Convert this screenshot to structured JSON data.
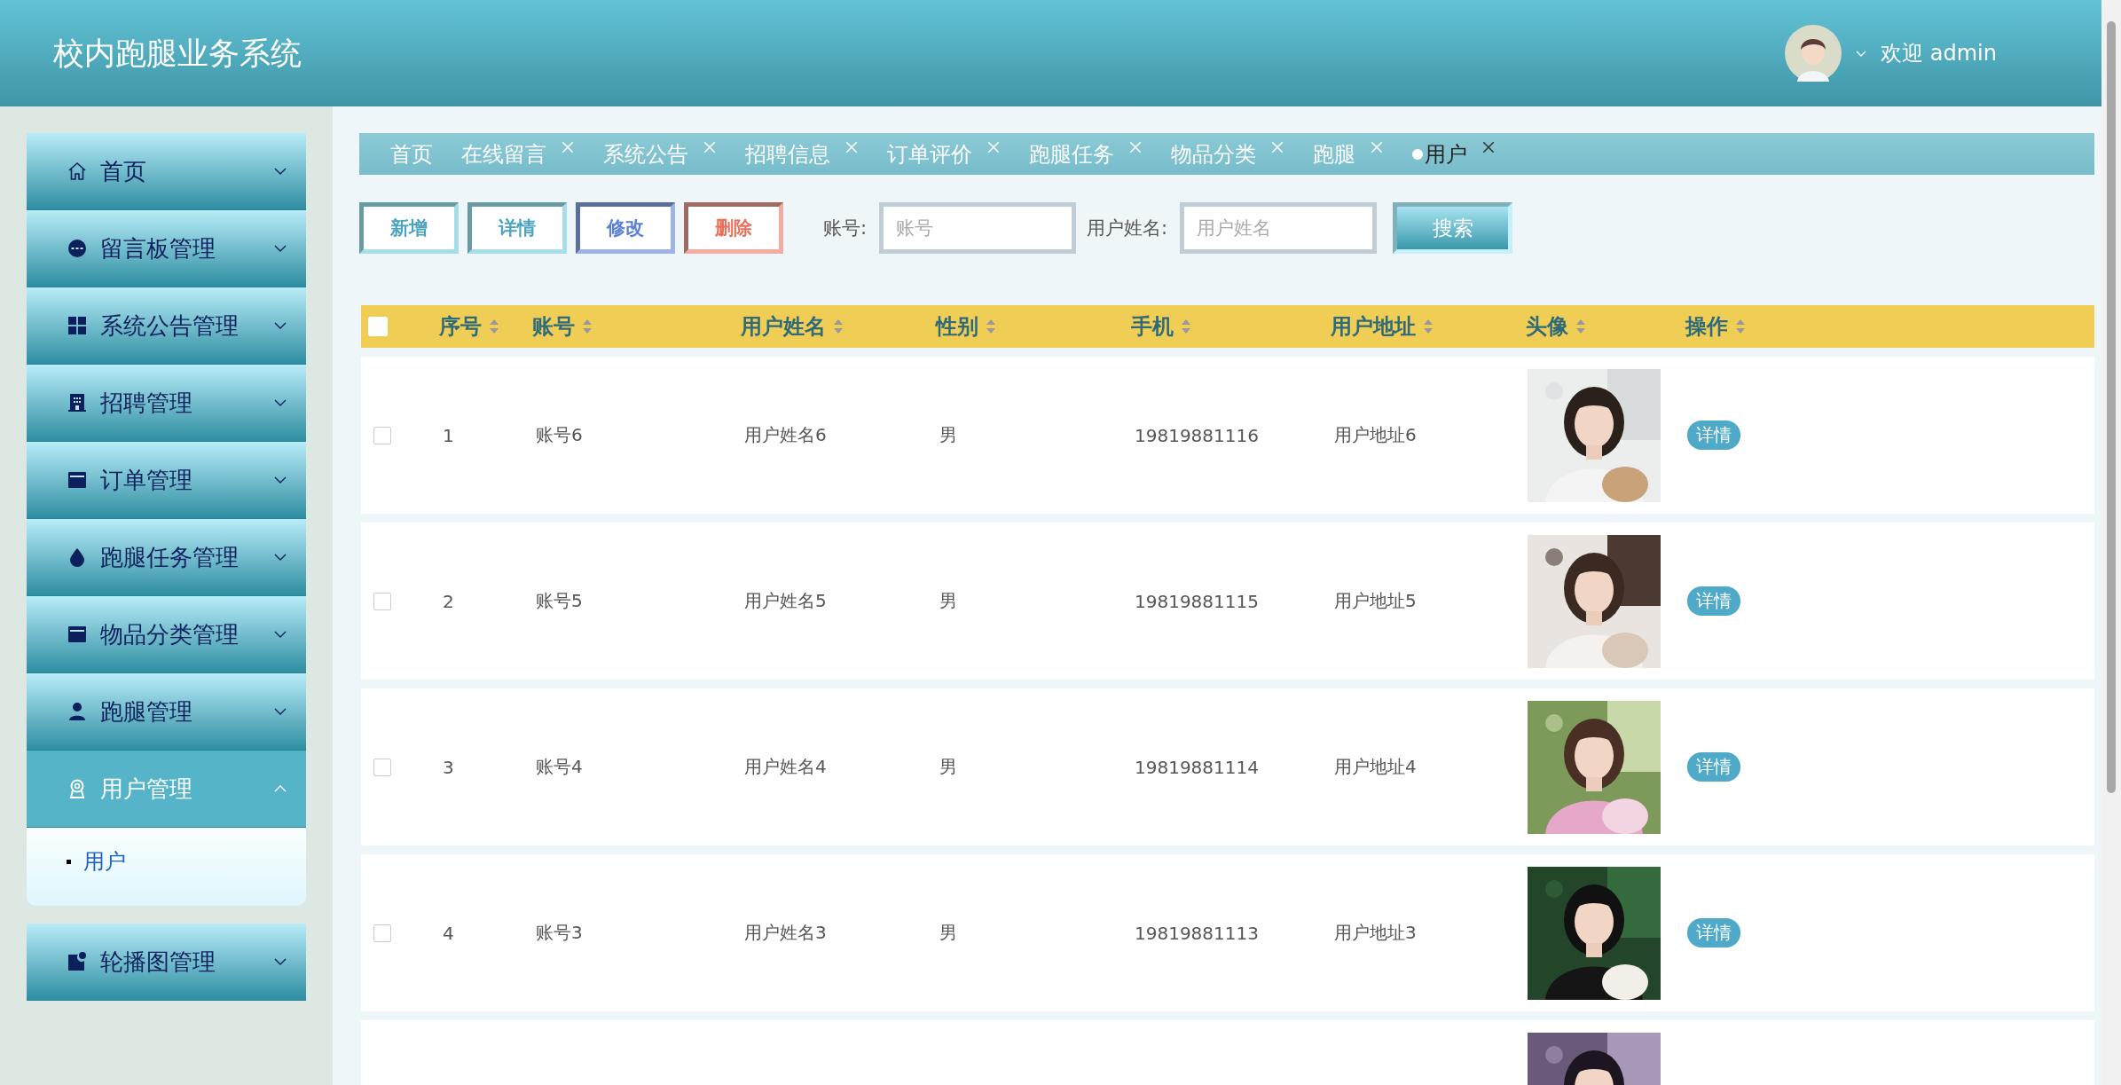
{
  "header": {
    "title": "校内跑腿业务系统",
    "welcome": "欢迎 admin"
  },
  "sidebar": {
    "items": [
      {
        "label": "首页",
        "selected": false,
        "expanded": false
      },
      {
        "label": "留言板管理",
        "selected": false,
        "expanded": false
      },
      {
        "label": "系统公告管理",
        "selected": false,
        "expanded": false
      },
      {
        "label": "招聘管理",
        "selected": false,
        "expanded": false
      },
      {
        "label": "订单管理",
        "selected": false,
        "expanded": false
      },
      {
        "label": "跑腿任务管理",
        "selected": false,
        "expanded": false
      },
      {
        "label": "物品分类管理",
        "selected": false,
        "expanded": false
      },
      {
        "label": "跑腿管理",
        "selected": false,
        "expanded": false
      },
      {
        "label": "用户管理",
        "selected": true,
        "expanded": true,
        "children": [
          {
            "label": "用户",
            "selected": true
          }
        ]
      },
      {
        "label": "轮播图管理",
        "selected": false,
        "expanded": false
      }
    ]
  },
  "tabs": [
    {
      "label": "首页",
      "selected": false,
      "closable": false
    },
    {
      "label": "在线留言",
      "selected": false,
      "closable": true
    },
    {
      "label": "系统公告",
      "selected": false,
      "closable": true
    },
    {
      "label": "招聘信息",
      "selected": false,
      "closable": true
    },
    {
      "label": "订单评价",
      "selected": false,
      "closable": true
    },
    {
      "label": "跑腿任务",
      "selected": false,
      "closable": true
    },
    {
      "label": "物品分类",
      "selected": false,
      "closable": true
    },
    {
      "label": "跑腿",
      "selected": false,
      "closable": true
    },
    {
      "label": "用户",
      "selected": true,
      "closable": true
    }
  ],
  "toolbar": {
    "buttons": [
      {
        "label": "新增",
        "kind": "add"
      },
      {
        "label": "详情",
        "kind": "detail"
      },
      {
        "label": "修改",
        "kind": "edit"
      },
      {
        "label": "删除",
        "kind": "delete"
      }
    ],
    "filters": [
      {
        "label": "账号:",
        "placeholder": "账号"
      },
      {
        "label": "用户姓名:",
        "placeholder": "用户姓名"
      }
    ],
    "search_button": "搜索"
  },
  "table": {
    "select_all": {
      "checked": false
    },
    "columns": [
      "序号",
      "账号",
      "用户姓名",
      "性别",
      "手机",
      "用户地址",
      "头像",
      "操作"
    ],
    "rows": [
      {
        "checked": false,
        "cells": [
          "1",
          "账号6",
          "用户姓名6",
          "男",
          "19819881116",
          "用户地址6"
        ],
        "photo": {
          "kind": "picture"
        },
        "action": "详情"
      },
      {
        "checked": false,
        "cells": [
          "2",
          "账号5",
          "用户姓名5",
          "男",
          "19819881115",
          "用户地址5"
        ],
        "photo": {
          "kind": "picture"
        },
        "action": "详情"
      },
      {
        "checked": false,
        "cells": [
          "3",
          "账号4",
          "用户姓名4",
          "男",
          "19819881114",
          "用户地址4"
        ],
        "photo": {
          "kind": "picture"
        },
        "action": "详情"
      },
      {
        "checked": false,
        "cells": [
          "4",
          "账号3",
          "用户姓名3",
          "男",
          "19819881113",
          "用户地址3"
        ],
        "photo": {
          "kind": "picture"
        },
        "action": "详情"
      }
    ],
    "cut_off_row": {
      "photo": {
        "kind": "picture"
      }
    }
  }
}
